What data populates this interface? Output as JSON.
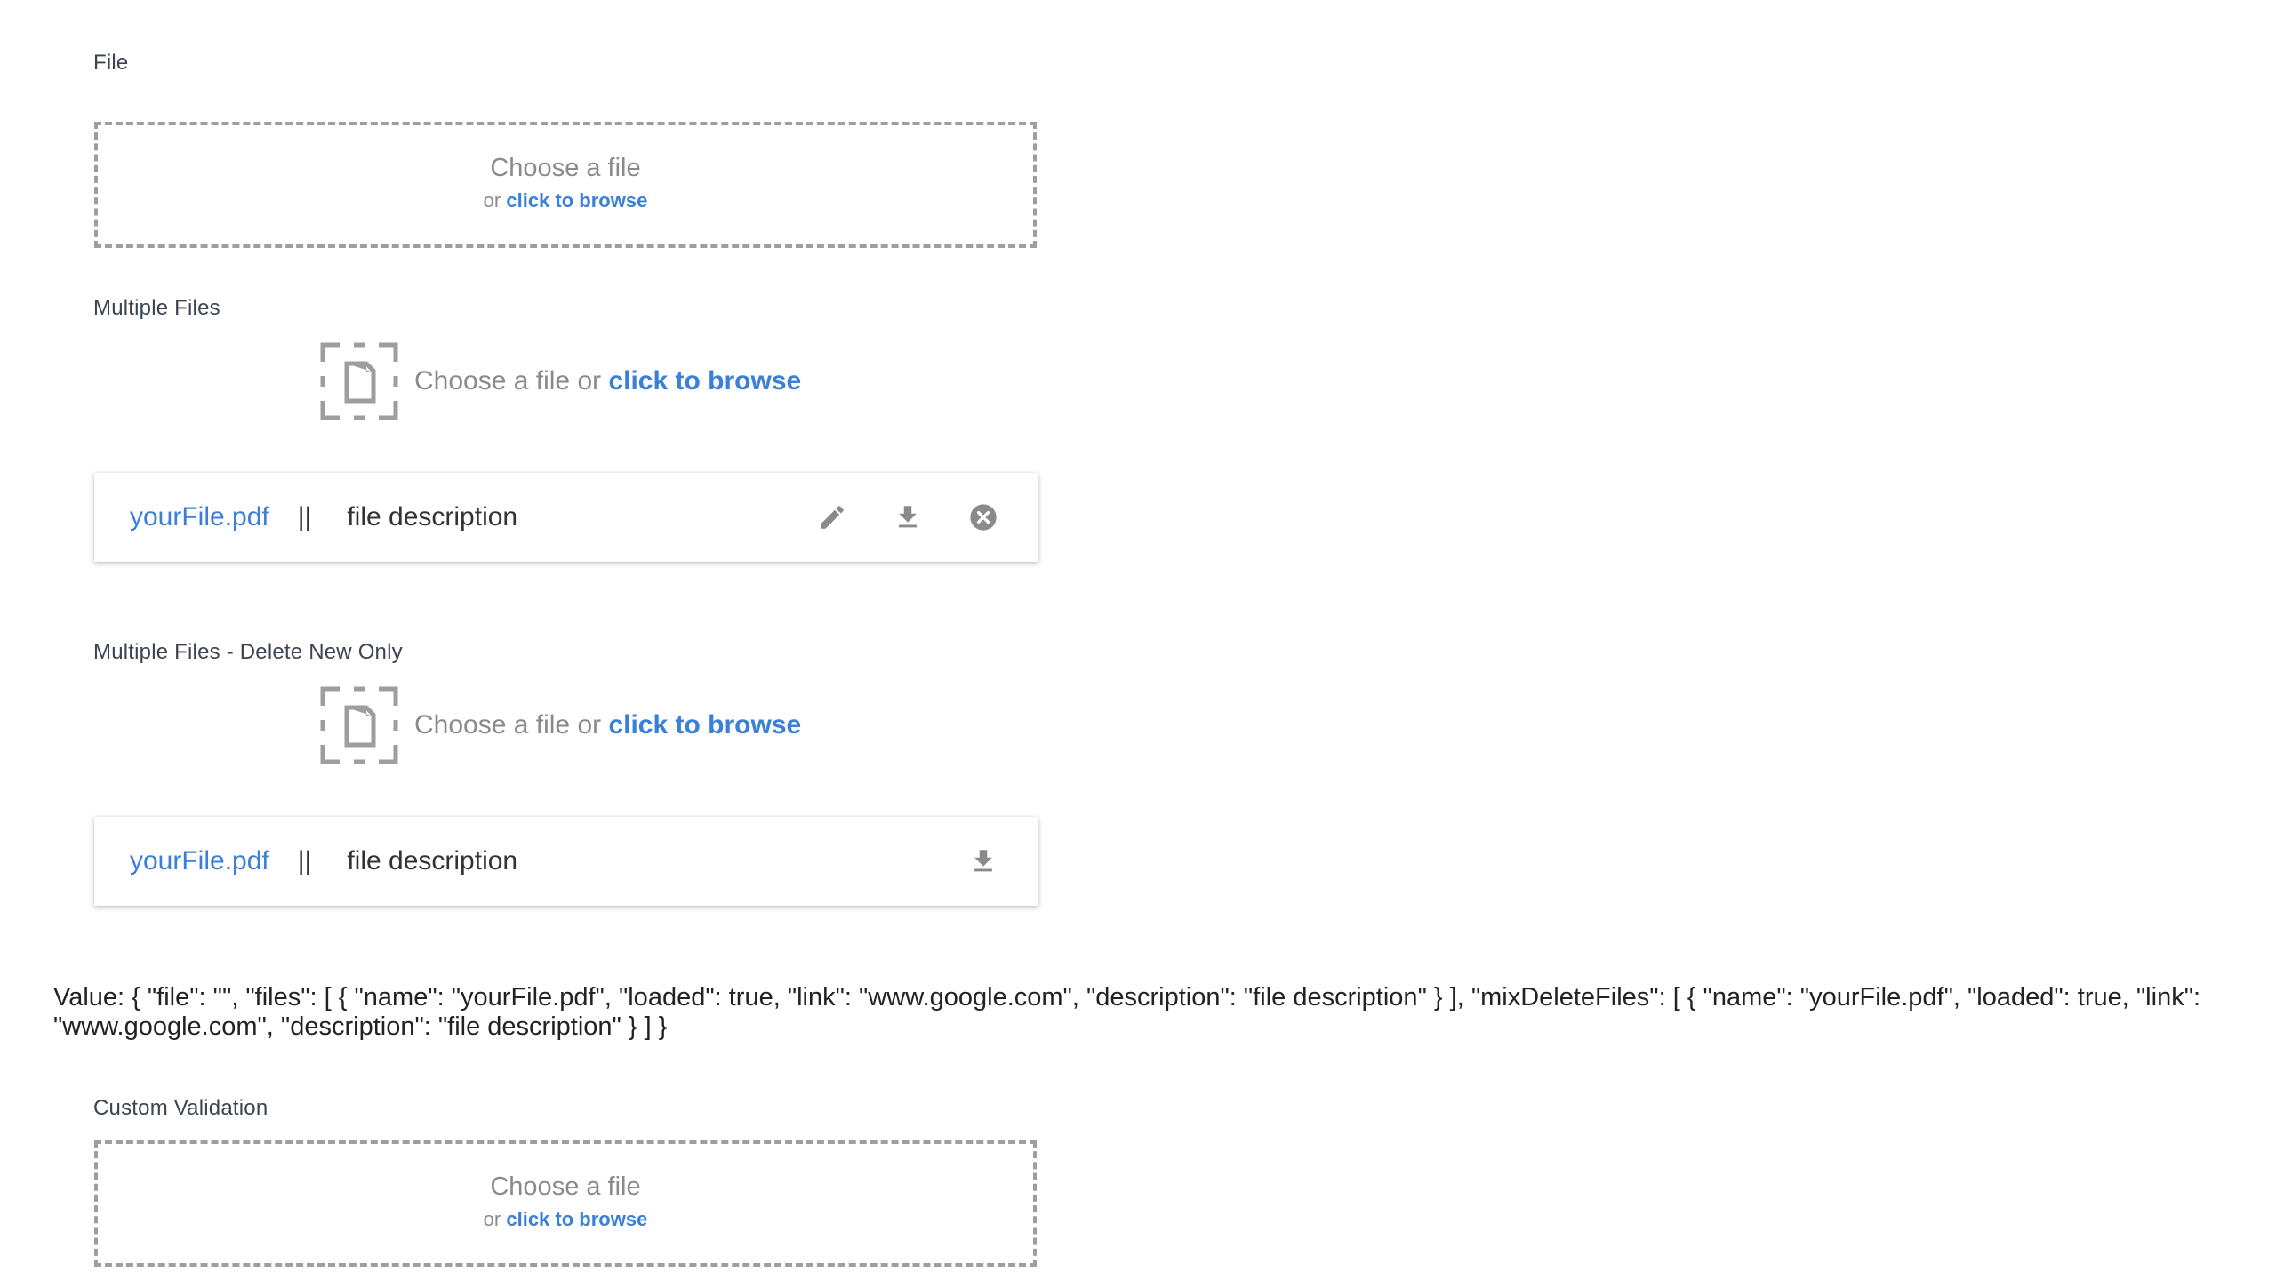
{
  "sections": {
    "file": {
      "label": "File",
      "drop_main": "Choose a file",
      "drop_or": "or ",
      "drop_browse": "click to browse"
    },
    "multiple_files": {
      "label": "Multiple Files",
      "drop_text": "Choose a file or ",
      "drop_browse": "click to browse",
      "items": [
        {
          "name": "yourFile.pdf",
          "separator": "||",
          "description": "file description"
        }
      ]
    },
    "multiple_delete_new": {
      "label": "Multiple Files - Delete New Only",
      "drop_text": "Choose a file or ",
      "drop_browse": "click to browse",
      "items": [
        {
          "name": "yourFile.pdf",
          "separator": "||",
          "description": "file description"
        }
      ]
    },
    "value": {
      "text": "Value: { \"file\": \"\", \"files\": [ { \"name\": \"yourFile.pdf\", \"loaded\": true, \"link\": \"www.google.com\", \"description\": \"file description\" } ], \"mixDeleteFiles\": [ { \"name\": \"yourFile.pdf\", \"loaded\": true, \"link\": \"www.google.com\", \"description\": \"file description\" } ] }"
    },
    "custom_validation": {
      "label": "Custom Validation",
      "drop_main": "Choose a file",
      "drop_or": "or ",
      "drop_browse": "click to browse"
    }
  },
  "icons": {
    "file_drop": "file-drop-icon",
    "edit": "pencil-icon",
    "download": "download-icon",
    "remove": "close-circle-icon"
  },
  "colors": {
    "link": "#3a7fd8",
    "muted": "#8a8a8a",
    "icon": "#9e9e9e"
  }
}
